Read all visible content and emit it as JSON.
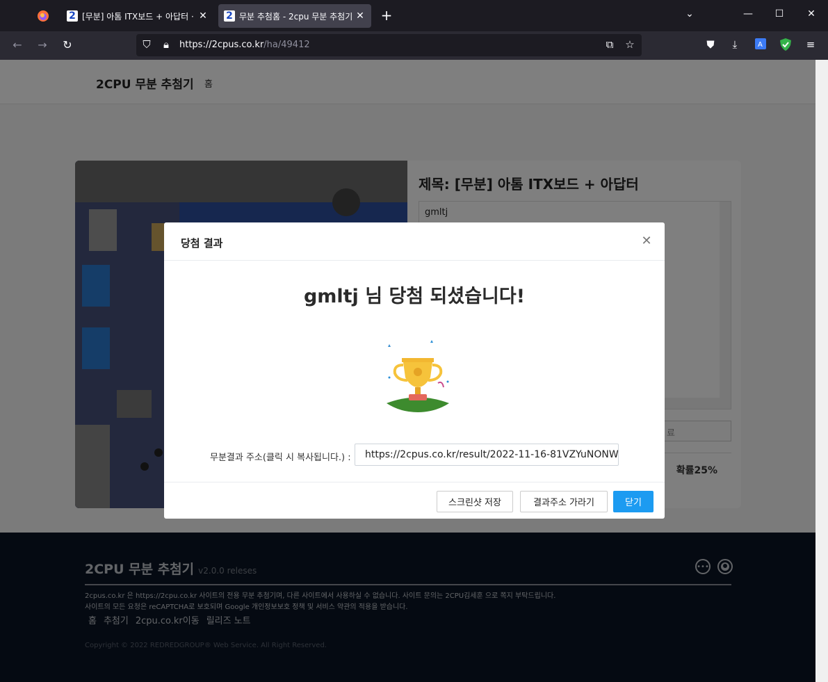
{
  "browser": {
    "tabs": [
      {
        "favicon": "2",
        "label": "[무분] 아톰 ITX보드 + 아답터 ·",
        "close": "✕"
      },
      {
        "favicon": "2",
        "label": "무분 추첨홈 - 2cpu 무분 추첨기",
        "close": "✕"
      }
    ],
    "url_host": "https://2cpus.co.kr",
    "url_path": "/ha/49412"
  },
  "site": {
    "brand": "2CPU 무분 추첨기",
    "home": "홈"
  },
  "card": {
    "title": "제목: [무분] 아톰 ITX보드 + 아답터",
    "textarea_value": "gmltj",
    "probability": "확률25%",
    "button_partial": "료"
  },
  "modal": {
    "title": "당첨 결과",
    "close": "✕",
    "winner_text": "gmltj 님 당첨 되셨습니다!",
    "result_label": "무분결과 주소(클릭 시 복사됩니다.) :",
    "result_url": "https://2cpus.co.kr/result/2022-11-16-81VZYuNONW",
    "buttons": {
      "screenshot": "스크린샷 저장",
      "goto_result": "결과주소 가라기",
      "close": "닫기"
    }
  },
  "footer": {
    "brand": "2CPU 무분 추첨기",
    "version": "v2.0.0 releses",
    "desc1": "2cpus.co.kr 은 https://2cpu.co.kr 사이트의 전용 무분 추첨기며, 다른 사이트에서 사용하실 수 없습니다. 사이트 문의는 2CPU김세훈 으로 쪽지 부탁드립니다.",
    "desc2": "사이트의 모든 요청은 reCAPTCHA로 보호되며 Google 개인정보보호 정책 및 서비스 약관의 적용을 받습니다.",
    "links": [
      "홈",
      "추첨기",
      "2cpu.co.kr이동",
      "릴리즈 노트"
    ],
    "copyright": "Copyright © 2022 REDREDGROUP® Web Service. All Right Reserved."
  },
  "colors": {
    "primary": "#1c9bf1",
    "footer_bg": "#0b1524",
    "browser_bg": "#1c1b22"
  }
}
